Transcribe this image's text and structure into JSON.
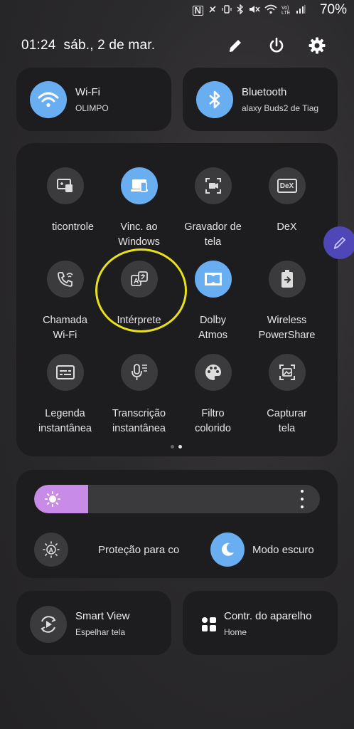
{
  "status_bar": {
    "battery": "70%",
    "icons": [
      "nfc-icon",
      "mute-icon",
      "vibrate-icon",
      "bluetooth-icon",
      "silent-icon",
      "wifi-icon",
      "volte-icon",
      "signal-icon"
    ],
    "volte_label": "Vo) LTE"
  },
  "header": {
    "datetime": "01:24  sáb., 2 de mar."
  },
  "wifi": {
    "title": "Wi-Fi",
    "subtitle": "OLIMPO"
  },
  "bluetooth": {
    "title": "Bluetooth",
    "subtitle": "alaxy Buds2 de Tiag"
  },
  "grid": {
    "tiles": [
      {
        "label": "ticontrole",
        "state": "off",
        "icon": "remote-icon"
      },
      {
        "label": "Vinc. ao\nWindows",
        "state": "on",
        "icon": "link-windows-icon"
      },
      {
        "label": "Gravador de\ntela",
        "state": "off",
        "icon": "screen-recorder-icon"
      },
      {
        "label": "DeX",
        "state": "off",
        "icon": "dex-icon",
        "icon_text": "DeX"
      },
      {
        "label": "Chamada\nWi-Fi",
        "state": "off",
        "icon": "wifi-call-icon"
      },
      {
        "label": "Intérprete",
        "state": "off",
        "icon": "interpreter-icon"
      },
      {
        "label": "Dolby\nAtmos",
        "state": "on",
        "icon": "dolby-icon"
      },
      {
        "label": "Wireless\nPowerShare",
        "state": "off",
        "icon": "powershare-icon"
      },
      {
        "label": "Legenda\ninstantânea",
        "state": "off",
        "icon": "live-caption-icon"
      },
      {
        "label": "Transcrição\ninstantânea",
        "state": "off",
        "icon": "live-transcribe-icon"
      },
      {
        "label": "Filtro\ncolorido",
        "state": "off",
        "icon": "color-filter-icon"
      },
      {
        "label": "Capturar\ntela",
        "state": "off",
        "icon": "screenshot-icon"
      }
    ],
    "page_count": 2,
    "current_page": 2
  },
  "brightness": {
    "level": 0.15
  },
  "eye_comfort": {
    "label": "Proteção para co",
    "state": "off"
  },
  "dark_mode": {
    "label": "Modo escuro",
    "state": "on"
  },
  "smart_view": {
    "title": "Smart View",
    "subtitle": "Espelhar tela"
  },
  "device_control": {
    "title": "Contr. do aparelho",
    "subtitle": "Home"
  },
  "colors": {
    "accent": "#6aaef2",
    "brightness_fill": "#c88be8",
    "highlight_circle": "#e8e11a",
    "edge_panel": "#4f47b8"
  }
}
